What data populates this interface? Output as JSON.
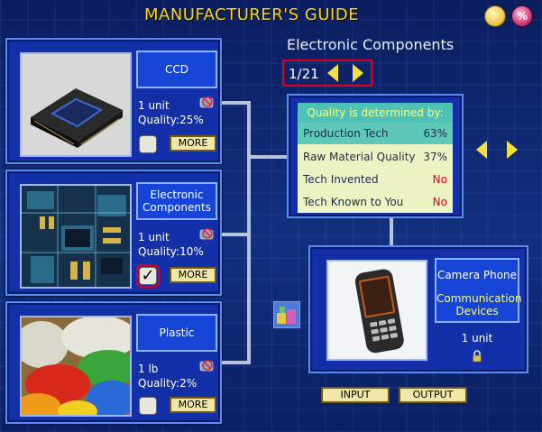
{
  "header": {
    "title": "MANUFACTURER'S GUIDE"
  },
  "toolbar": {
    "bulb_icon": "lightbulb-icon",
    "percent_icon": "percent-icon",
    "percent_label": "%"
  },
  "materials": [
    {
      "name": "CCD",
      "quantity": "1 unit",
      "quality_label": "Quality:",
      "quality_value": "25%",
      "selected": false,
      "more_label": "MORE"
    },
    {
      "name": "Electronic Components",
      "quantity": "1 unit",
      "quality_label": "Quality:",
      "quality_value": "10%",
      "selected": true,
      "more_label": "MORE"
    },
    {
      "name": "Plastic",
      "quantity": "1 lb",
      "quality_label": "Quality:",
      "quality_value": "2%",
      "selected": false,
      "more_label": "MORE"
    }
  ],
  "detail": {
    "heading": "Electronic Components",
    "pager": "1/21"
  },
  "quality_box": {
    "header": "Quality is determined by:",
    "rows": [
      {
        "label": "Production Tech",
        "value": "63%"
      },
      {
        "label": "Raw Material Quality",
        "value": "37%"
      },
      {
        "label": "Tech Invented",
        "value": "No"
      },
      {
        "label": "Tech Known to You",
        "value": "No"
      }
    ]
  },
  "product": {
    "name": "Camera Phone",
    "category": "Communication Devices",
    "quantity": "1 unit"
  },
  "buttons": {
    "input_label": "INPUT",
    "output_label": "OUTPUT"
  },
  "colors": {
    "accent_yellow": "#ffd800",
    "panel_blue": "#1330a8",
    "highlight_red": "#e0001c",
    "value_red": "#e0001c"
  }
}
